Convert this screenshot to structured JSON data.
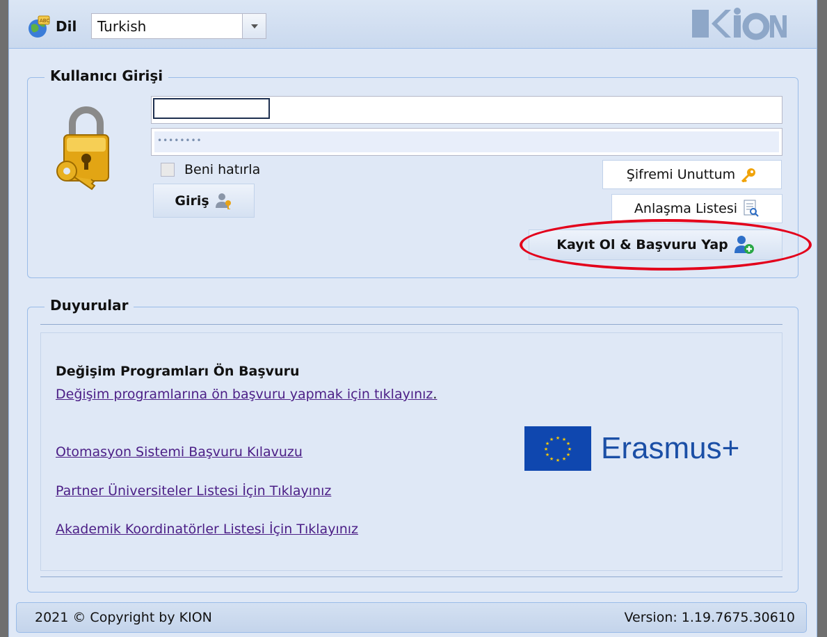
{
  "header": {
    "language_label": "Dil",
    "language_value": "Turkish",
    "logo_text": "KION"
  },
  "login": {
    "title": "Kullanıcı Girişi",
    "username_value": "",
    "password_mask": "••••••••",
    "remember_label": "Beni hatırla",
    "login_button": "Giriş",
    "forgot_button": "Şifremi Unuttum",
    "agreements_button": "Anlaşma Listesi",
    "register_button": "Kayıt Ol & Başvuru Yap"
  },
  "announcements": {
    "title": "Duyurular",
    "item_title": "Değişim Programları Ön Başvuru",
    "link1": "Değişim programlarına ön başvuru yapmak için tıklayınız",
    "link1_suffix": ".",
    "link2": "Otomasyon Sistemi Başvuru Kılavuzu",
    "link3": "Partner Üniversiteler Listesi İçin Tıklayınız",
    "link4": "Akademik Koordinatörler Listesi İçin Tıklayınız",
    "erasmus_text": "Erasmus+"
  },
  "footer": {
    "copyright": "2021 © Copyright by KION",
    "version": "Version: 1.19.7675.30610"
  },
  "colors": {
    "accent": "#99bbe8",
    "link": "#4b1e86",
    "highlight": "#e3001b",
    "eu_blue": "#0f47af"
  }
}
